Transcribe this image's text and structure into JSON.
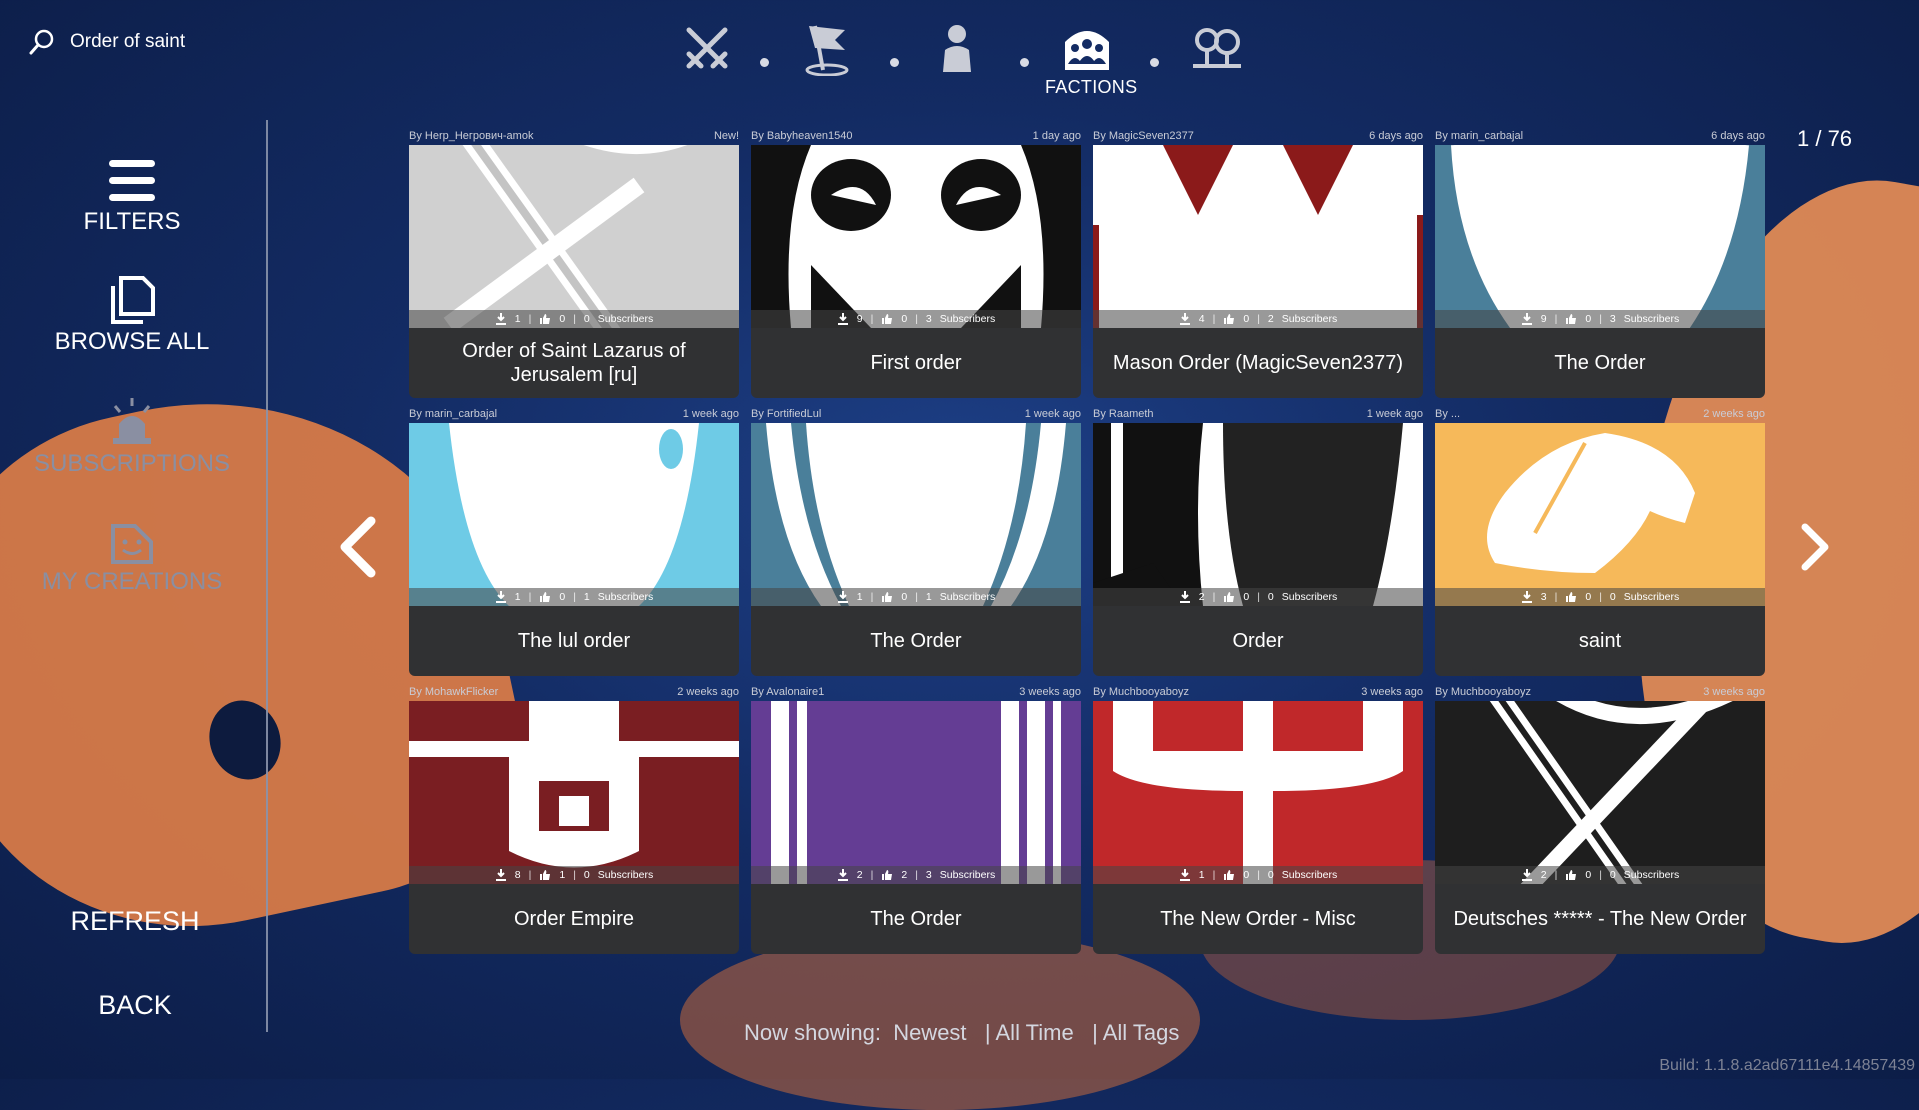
{
  "search": {
    "query": "Order of saint"
  },
  "topnav": {
    "active_label": "FACTIONS",
    "items": [
      "weapons-icon",
      "flag-icon",
      "unit-icon",
      "factions-icon",
      "maps-icon"
    ]
  },
  "sidebar": {
    "filters": "FILTERS",
    "browse_all": "BROWSE ALL",
    "subscriptions": "SUBSCRIPTIONS",
    "my_creations": "MY CREATIONS",
    "refresh": "REFRESH",
    "back": "BACK"
  },
  "pagination": {
    "counter": "1 / 76"
  },
  "cards": [
    {
      "author": "By Herp_Негрович-amok",
      "age": "New!",
      "downloads": "1",
      "likes": "0",
      "subscribers": "0",
      "subscribers_label": "Subscribers",
      "title": "Order of Saint Lazarus of Jerusalem [ru]"
    },
    {
      "author": "By Babyheaven1540",
      "age": "1 day ago",
      "downloads": "9",
      "likes": "0",
      "subscribers": "3",
      "subscribers_label": "Subscribers",
      "title": "First order"
    },
    {
      "author": "By MagicSeven2377",
      "age": "6 days ago",
      "downloads": "4",
      "likes": "0",
      "subscribers": "2",
      "subscribers_label": "Subscribers",
      "title": "Mason Order (MagicSeven2377)"
    },
    {
      "author": "By marin_carbajal",
      "age": "6 days ago",
      "downloads": "9",
      "likes": "0",
      "subscribers": "3",
      "subscribers_label": "Subscribers",
      "title": "The Order"
    },
    {
      "author": "By marin_carbajal",
      "age": "1 week ago",
      "downloads": "1",
      "likes": "0",
      "subscribers": "1",
      "subscribers_label": "Subscribers",
      "title": "The lul order"
    },
    {
      "author": "By FortifiedLul",
      "age": "1 week ago",
      "downloads": "1",
      "likes": "0",
      "subscribers": "1",
      "subscribers_label": "Subscribers",
      "title": "The Order"
    },
    {
      "author": "By Raameth",
      "age": "1 week ago",
      "downloads": "2",
      "likes": "0",
      "subscribers": "0",
      "subscribers_label": "Subscribers",
      "title": "Order"
    },
    {
      "author": "By ...",
      "age": "2 weeks ago",
      "downloads": "3",
      "likes": "0",
      "subscribers": "0",
      "subscribers_label": "Subscribers",
      "title": "saint"
    },
    {
      "author": "By MohawkFlicker",
      "age": "2 weeks ago",
      "downloads": "8",
      "likes": "1",
      "subscribers": "0",
      "subscribers_label": "Subscribers",
      "title": "Order Empire"
    },
    {
      "author": "By Avalonaire1",
      "age": "3 weeks ago",
      "downloads": "2",
      "likes": "2",
      "subscribers": "3",
      "subscribers_label": "Subscribers",
      "title": "The Order"
    },
    {
      "author": "By Muchbooyaboyz",
      "age": "3 weeks ago",
      "downloads": "1",
      "likes": "0",
      "subscribers": "0",
      "subscribers_label": "Subscribers",
      "title": "The New Order - Misc"
    },
    {
      "author": "By Muchbooyaboyz",
      "age": "3 weeks ago",
      "downloads": "2",
      "likes": "0",
      "subscribers": "0",
      "subscribers_label": "Subscribers",
      "title": "Deutsches ***** - The New Order"
    }
  ],
  "footer": {
    "now_showing_label": "Now showing:",
    "sort": "Newest",
    "time": "| All Time",
    "tags": "| All Tags",
    "build": "Build: 1.1.8.a2ad67111e4.14857439"
  },
  "colors": {
    "background": "#132b63",
    "card_title_bg": "#303133",
    "accent_orange": "#d77a48"
  }
}
